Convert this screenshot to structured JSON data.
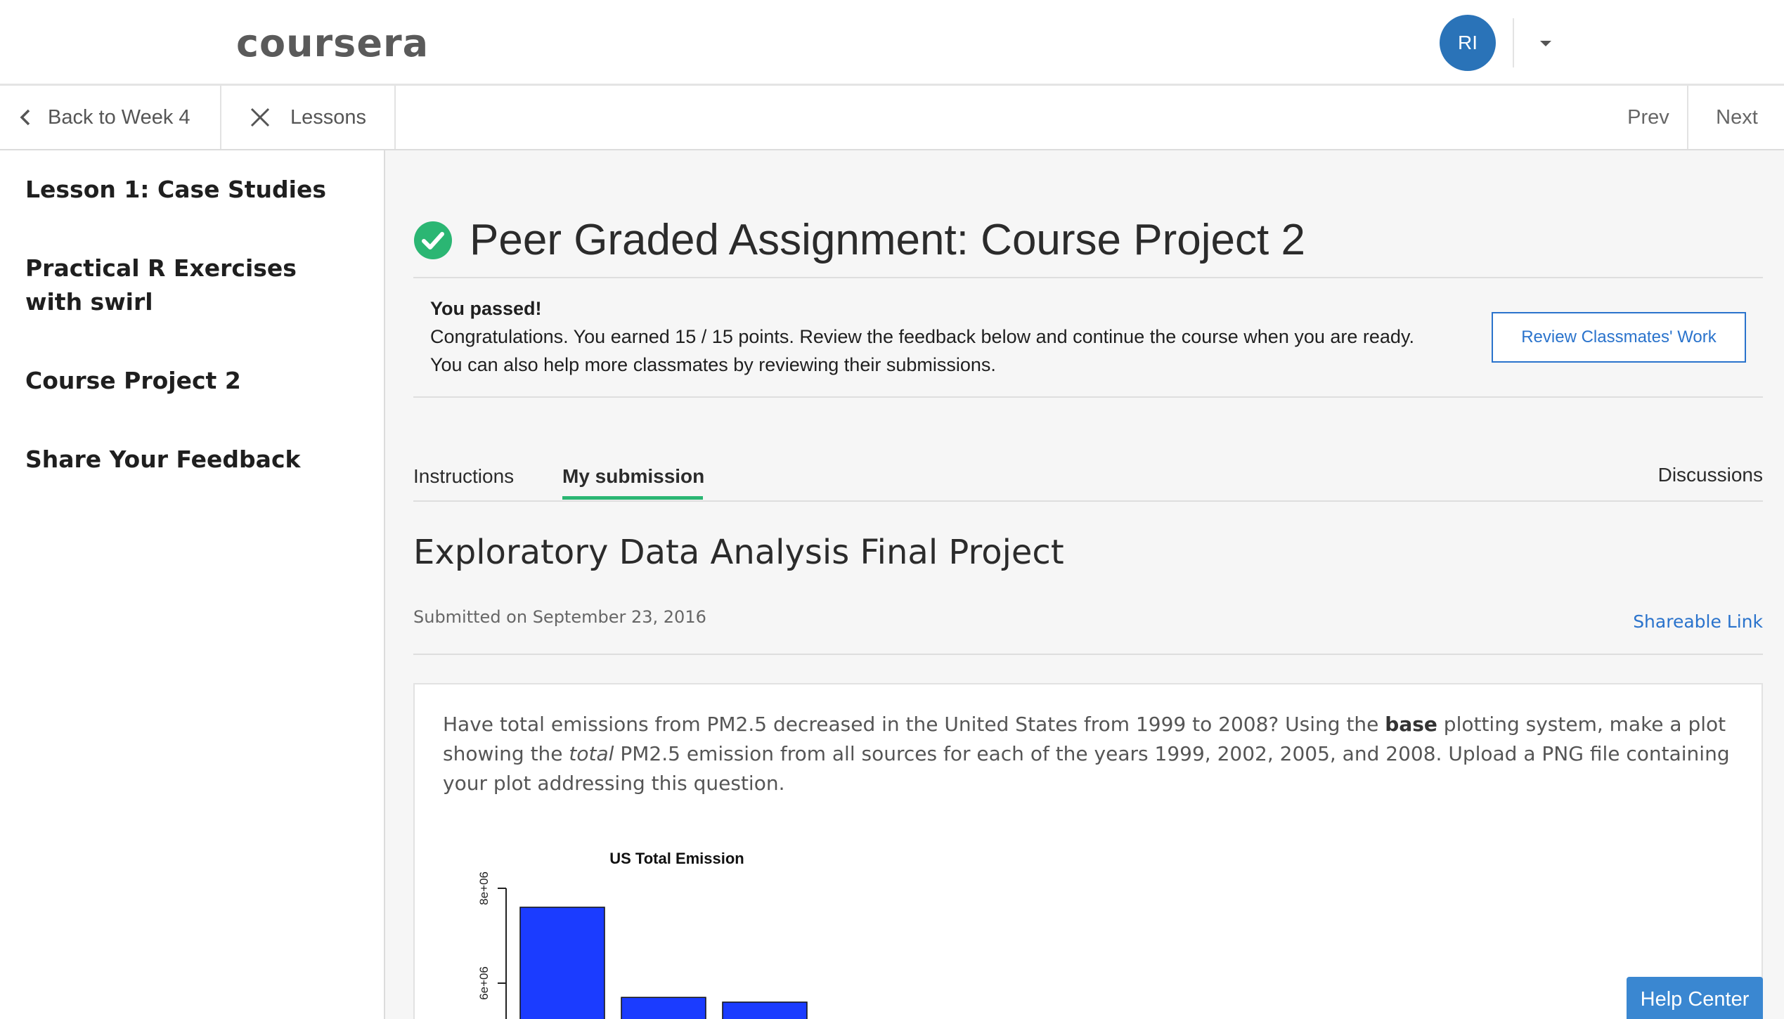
{
  "header": {
    "logo": "coursera",
    "avatar_initials": "RI"
  },
  "nav": {
    "back_label": "Back to Week 4",
    "lessons_label": "Lessons",
    "prev_label": "Prev",
    "next_label": "Next"
  },
  "sidebar": {
    "items": [
      {
        "label": "Lesson 1: Case Studies"
      },
      {
        "label": "Practical R Exercises with swirl"
      },
      {
        "label": "Course Project 2"
      },
      {
        "label": "Share Your Feedback"
      }
    ]
  },
  "assignment": {
    "title": "Peer Graded Assignment: Course Project 2",
    "status_title": "You passed!",
    "status_line1": "Congratulations. You earned 15 / 15 points. Review the feedback below and continue the course when you are ready.",
    "status_line2": "You can also help more classmates by reviewing their submissions.",
    "review_button": "Review Classmates' Work"
  },
  "tabs": {
    "instructions": "Instructions",
    "my_submission": "My submission",
    "discussions": "Discussions",
    "active": "My submission"
  },
  "submission": {
    "title": "Exploratory Data Analysis Final Project",
    "submitted": "Submitted on September 23, 2016",
    "shareable_link": "Shareable Link",
    "question_pre": "Have total emissions from PM2.5 decreased in the United States from 1999 to 2008? Using the ",
    "question_base": "base",
    "question_mid": " plotting system, make a plot showing the ",
    "question_total": "total",
    "question_post": " PM2.5 emission from all sources for each of the years 1999, 2002, 2005, and 2008. Upload a PNG file containing your plot addressing this question."
  },
  "chart_data": {
    "type": "bar",
    "title": "US Total Emission",
    "categories": [
      "",
      "",
      ""
    ],
    "values": [
      7600000,
      5700000,
      5600000
    ],
    "ytick_labels": [
      "8e+06",
      "6e+06"
    ],
    "yticks": [
      8000000,
      6000000
    ],
    "visible_y_min": 5500000,
    "bar_color": "#1b3cff"
  },
  "help": {
    "label": "Help Center"
  },
  "colors": {
    "accent_blue": "#2a73cc",
    "success_green": "#2bb673",
    "avatar_blue": "#2a73b8"
  }
}
